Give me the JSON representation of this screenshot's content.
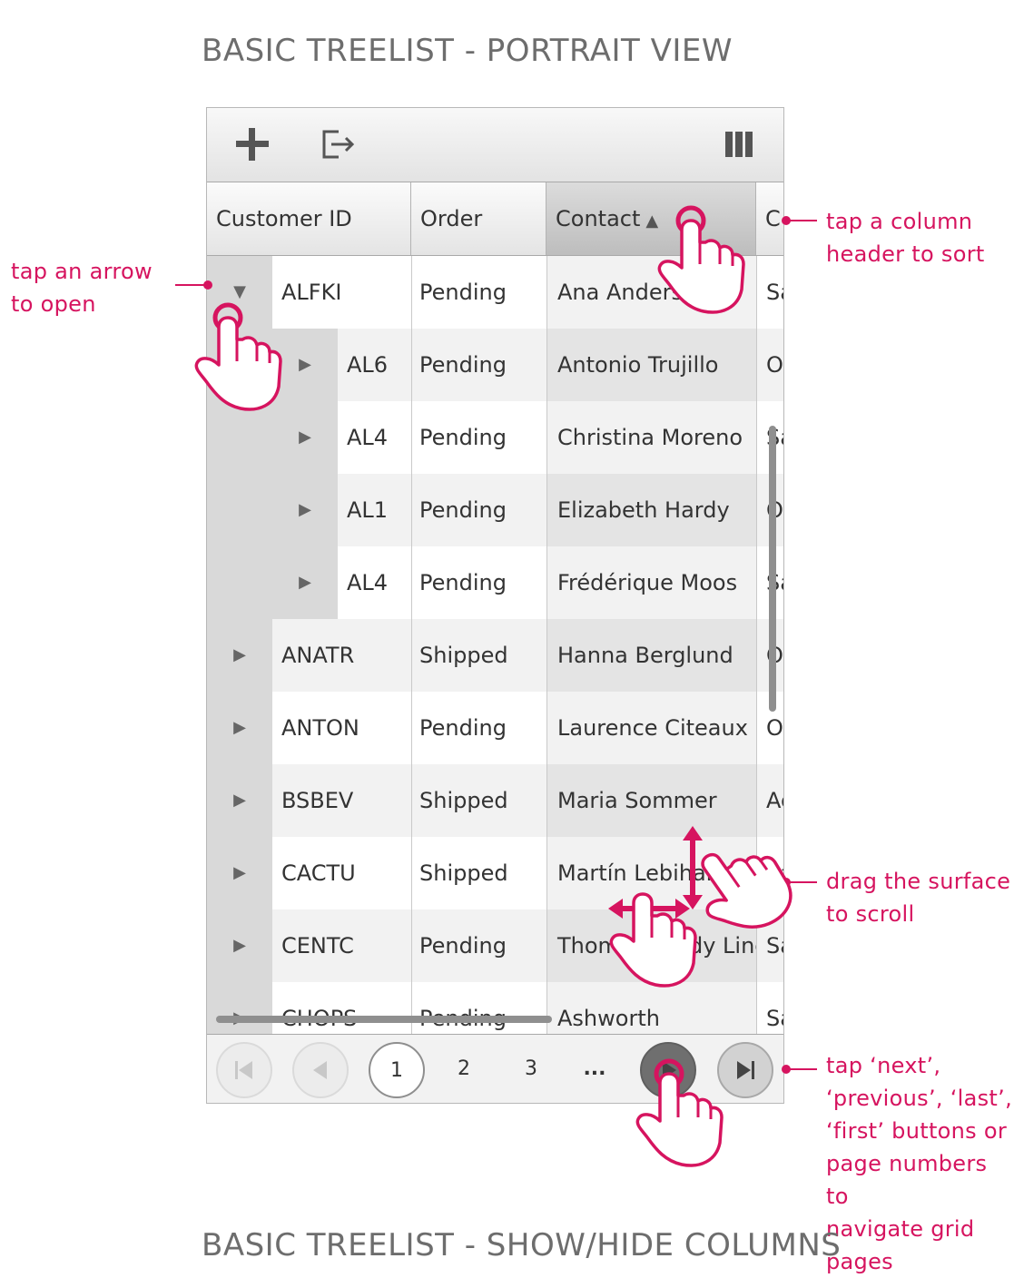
{
  "page_title": "BASIC TREELIST - PORTRAIT VIEW",
  "next_section_title": "BASIC TREELIST - SHOW/HIDE COLUMNS",
  "toolbar": {
    "add_icon": "plus-icon",
    "export_icon": "export-icon",
    "columns_icon": "columns-icon"
  },
  "columns": {
    "customer_id": "Customer ID",
    "order": "Order",
    "contact": "Contact",
    "extra": "C",
    "sort_indicator": "▲"
  },
  "rows": [
    {
      "id": "ALFKI",
      "order": "Pending",
      "contact": "Ana Anders",
      "extra": "Sa",
      "level": 0,
      "expanded": true
    },
    {
      "id": "AL6",
      "order": "Pending",
      "contact": "Antonio Trujillo",
      "extra": "Ow",
      "level": 1,
      "expanded": false
    },
    {
      "id": "AL4",
      "order": "Pending",
      "contact": "Christina Moreno",
      "extra": "Sa",
      "level": 1,
      "expanded": false
    },
    {
      "id": "AL1",
      "order": "Pending",
      "contact": "Elizabeth Hardy",
      "extra": "Ow",
      "level": 1,
      "expanded": false
    },
    {
      "id": "AL4",
      "order": "Pending",
      "contact": "Frédérique Moos",
      "extra": "Sa",
      "level": 1,
      "expanded": false
    },
    {
      "id": "ANATR",
      "order": "Shipped",
      "contact": "Hanna Berglund",
      "extra": "Ow",
      "level": 0,
      "expanded": false
    },
    {
      "id": "ANTON",
      "order": "Pending",
      "contact": "Laurence Citeaux",
      "extra": "Ow",
      "level": 0,
      "expanded": false
    },
    {
      "id": "BSBEV",
      "order": "Shipped",
      "contact": "Maria Sommer",
      "extra": "Ac",
      "level": 0,
      "expanded": false
    },
    {
      "id": "CACTU",
      "order": "Shipped",
      "contact": "Martín Lebihan",
      "extra": "Sa",
      "level": 0,
      "expanded": false
    },
    {
      "id": "CENTC",
      "order": "Pending",
      "contact": "Thomas Hardy Lincoln",
      "extra": "Sa",
      "level": 0,
      "expanded": false
    },
    {
      "id": "CHOPS",
      "order": "Pending",
      "contact": "Ashworth",
      "extra": "Sa",
      "level": 0,
      "expanded": false
    }
  ],
  "pager": {
    "pages": [
      "1",
      "2",
      "3",
      "..."
    ],
    "current_page": "1",
    "first_icon": "first-page-icon",
    "prev_icon": "previous-page-icon",
    "next_icon": "next-page-icon",
    "last_icon": "last-page-icon"
  },
  "annotations": {
    "sort": [
      "tap a column",
      "header to sort"
    ],
    "open": [
      "tap an arrow",
      "to open"
    ],
    "scroll": [
      "drag the surface",
      "to scroll"
    ],
    "navigate": [
      "tap ‘next’,",
      "‘previous’, ‘last’,",
      "‘first’ buttons or",
      "page numbers to",
      "navigate grid",
      "pages"
    ]
  },
  "colors": {
    "accent": "#d6145f",
    "row_alt": "#f2f2f2",
    "sorted_column": "#e6e6e6",
    "indent": "#d9d9d9"
  }
}
